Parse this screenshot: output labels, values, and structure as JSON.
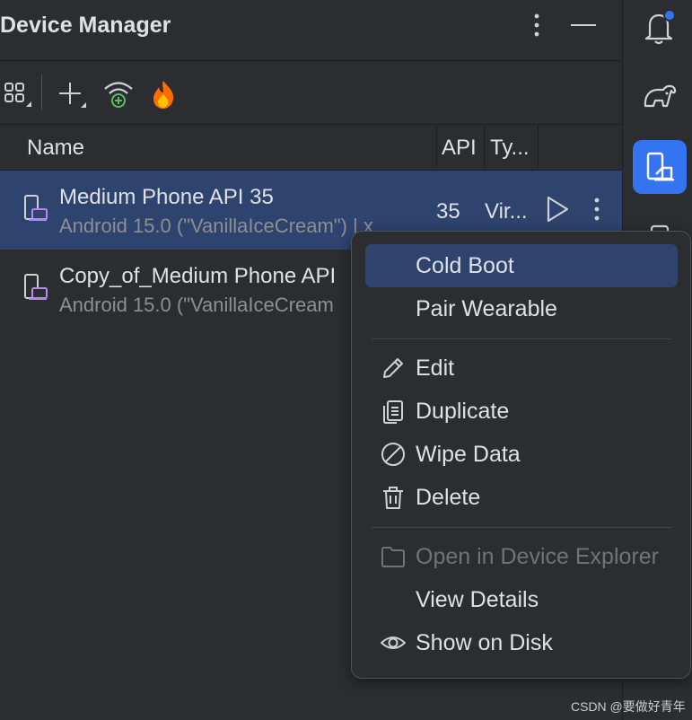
{
  "panel": {
    "title": "Device Manager"
  },
  "table": {
    "columns": [
      "Name",
      "API",
      "Ty..."
    ]
  },
  "devices": [
    {
      "name": "Medium Phone API 35",
      "subtitle": "Android 15.0 (\"VanillaIceCream\") | x",
      "api": "35",
      "type": "Vir..."
    },
    {
      "name": "Copy_of_Medium Phone API",
      "subtitle": "Android 15.0 (\"VanillaIceCream",
      "api": "",
      "type": ""
    }
  ],
  "context_menu": {
    "items": [
      {
        "label": "Cold Boot",
        "icon": "",
        "highlighted": true
      },
      {
        "label": "Pair Wearable",
        "icon": ""
      },
      {
        "label": "Edit",
        "icon": "pencil-icon"
      },
      {
        "label": "Duplicate",
        "icon": "duplicate-icon"
      },
      {
        "label": "Wipe Data",
        "icon": "prohibit-icon"
      },
      {
        "label": "Delete",
        "icon": "trash-icon"
      },
      {
        "label": "Open in Device Explorer",
        "icon": "folder-icon",
        "disabled": true
      },
      {
        "label": "View Details",
        "icon": ""
      },
      {
        "label": "Show on Disk",
        "icon": "eye-icon"
      }
    ]
  },
  "watermark": "CSDN @要做好青年",
  "colors": {
    "background": "#2b2d30",
    "selection": "#2e436e",
    "accent": "#3574f0",
    "device_icon": "#b589ec",
    "notification_dot": "#3574f0"
  }
}
